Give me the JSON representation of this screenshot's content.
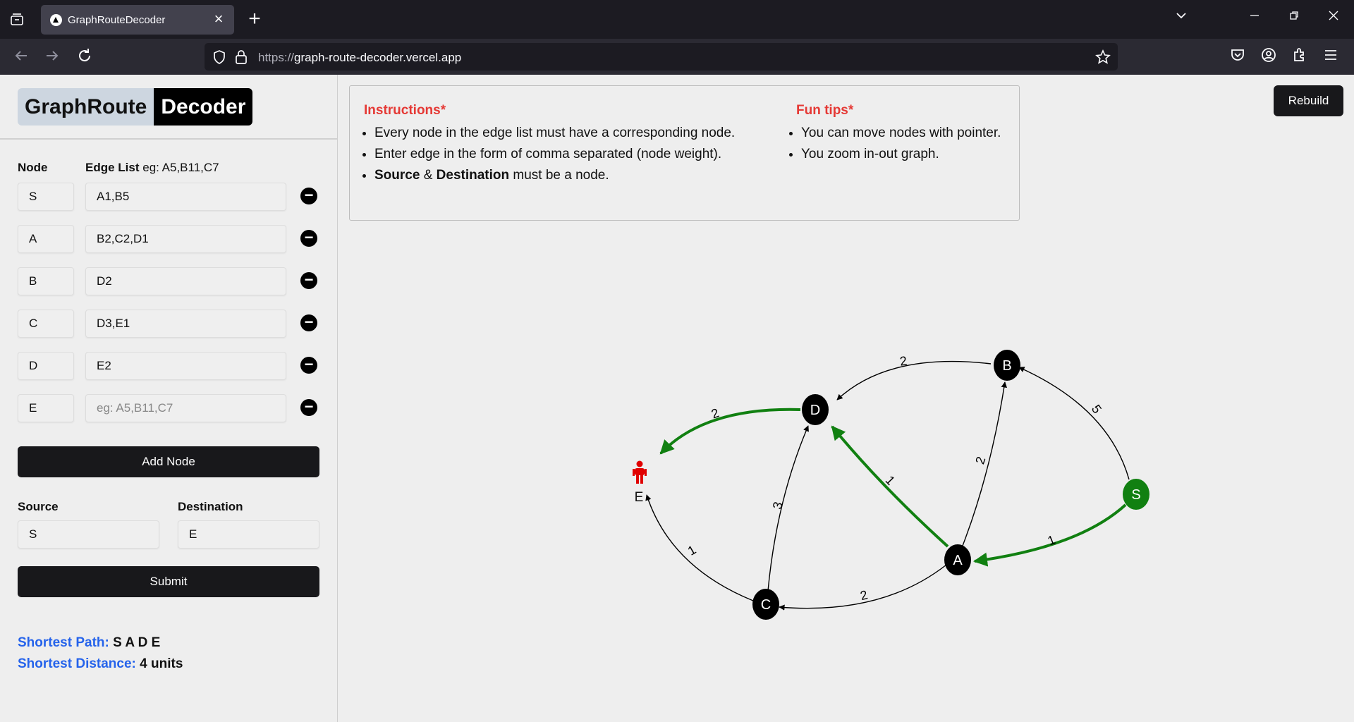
{
  "browser": {
    "tab_title": "GraphRouteDecoder",
    "url_protocol": "https://",
    "url_host": "graph-route-decoder.vercel.app"
  },
  "logo": {
    "part1": "GraphRoute",
    "part2": "Decoder"
  },
  "form": {
    "node_header": "Node",
    "edge_header": "Edge List",
    "edge_hint": "eg: A5,B11,C7",
    "rows": [
      {
        "node": "S",
        "edges": "A1,B5",
        "placeholder": ""
      },
      {
        "node": "A",
        "edges": "B2,C2,D1",
        "placeholder": ""
      },
      {
        "node": "B",
        "edges": "D2",
        "placeholder": ""
      },
      {
        "node": "C",
        "edges": "D3,E1",
        "placeholder": ""
      },
      {
        "node": "D",
        "edges": "E2",
        "placeholder": ""
      },
      {
        "node": "E",
        "edges": "",
        "placeholder": "eg: A5,B11,C7"
      }
    ],
    "add_node_label": "Add Node",
    "source_label": "Source",
    "destination_label": "Destination",
    "source_value": "S",
    "destination_value": "E",
    "submit_label": "Submit"
  },
  "result": {
    "path_label": "Shortest Path:",
    "path_value": "S A D E",
    "distance_label": "Shortest Distance:",
    "distance_value": "4 units"
  },
  "instructions": {
    "title": "Instructions*",
    "items": [
      "Every node in the edge list must have a corresponding node.",
      "Enter edge in the form of comma separated (node weight)."
    ],
    "item3_bold1": "Source",
    "item3_mid": " & ",
    "item3_bold2": "Destination",
    "item3_rest": " must be a node."
  },
  "fun_tips": {
    "title": "Fun tips*",
    "items": [
      "You can move nodes with pointer.",
      "You zoom in-out graph."
    ]
  },
  "rebuild_label": "Rebuild",
  "colors": {
    "path": "#118011",
    "source_node": "#118011",
    "destination_icon": "#e00000",
    "node": "#000000"
  },
  "graph": {
    "nodes": [
      "S",
      "A",
      "B",
      "C",
      "D",
      "E"
    ],
    "edges": [
      {
        "from": "S",
        "to": "A",
        "weight": "1",
        "on_path": true
      },
      {
        "from": "S",
        "to": "B",
        "weight": "5",
        "on_path": false
      },
      {
        "from": "A",
        "to": "B",
        "weight": "2",
        "on_path": false
      },
      {
        "from": "A",
        "to": "C",
        "weight": "2",
        "on_path": false
      },
      {
        "from": "A",
        "to": "D",
        "weight": "1",
        "on_path": true
      },
      {
        "from": "B",
        "to": "D",
        "weight": "2",
        "on_path": false
      },
      {
        "from": "C",
        "to": "D",
        "weight": "3",
        "on_path": false
      },
      {
        "from": "C",
        "to": "E",
        "weight": "1",
        "on_path": false
      },
      {
        "from": "D",
        "to": "E",
        "weight": "2",
        "on_path": true
      }
    ]
  }
}
